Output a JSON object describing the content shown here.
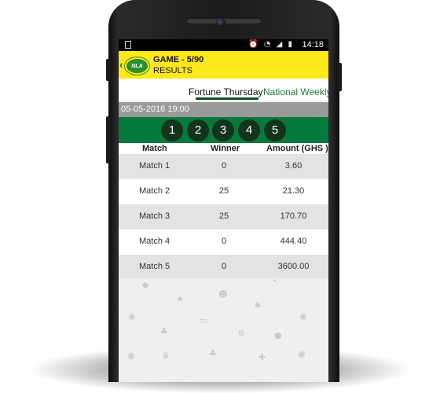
{
  "status_bar": {
    "time": "14:18",
    "icons": [
      "alarm-icon",
      "wifi-icon",
      "signal-icon",
      "battery-icon"
    ]
  },
  "app_bar": {
    "logo_text": "NLA",
    "title": "GAME - 5/90",
    "subtitle": "RESULTS"
  },
  "tabs": [
    {
      "label": "Fortune Thursday",
      "active": true
    },
    {
      "label": "National Weekly",
      "active": false
    }
  ],
  "draw_date": "05-05-2016 19:00",
  "winning_numbers": [
    "1",
    "2",
    "3",
    "4",
    "5"
  ],
  "table": {
    "headers": [
      "Match",
      "Winner",
      "Amount (GHS )"
    ],
    "rows": [
      {
        "match": "Match 1",
        "winner": "0",
        "amount": "3.60"
      },
      {
        "match": "Match 2",
        "winner": "25",
        "amount": "21.30"
      },
      {
        "match": "Match 3",
        "winner": "25",
        "amount": "170.70"
      },
      {
        "match": "Match 4",
        "winner": "0",
        "amount": "444.40"
      },
      {
        "match": "Match 5",
        "winner": "0",
        "amount": "3600.00"
      }
    ]
  },
  "colors": {
    "app_bar": "#ffe91c",
    "balls_bar": "#057a3c",
    "ball": "#12331c",
    "tab_indicator": "#0f4d24"
  }
}
